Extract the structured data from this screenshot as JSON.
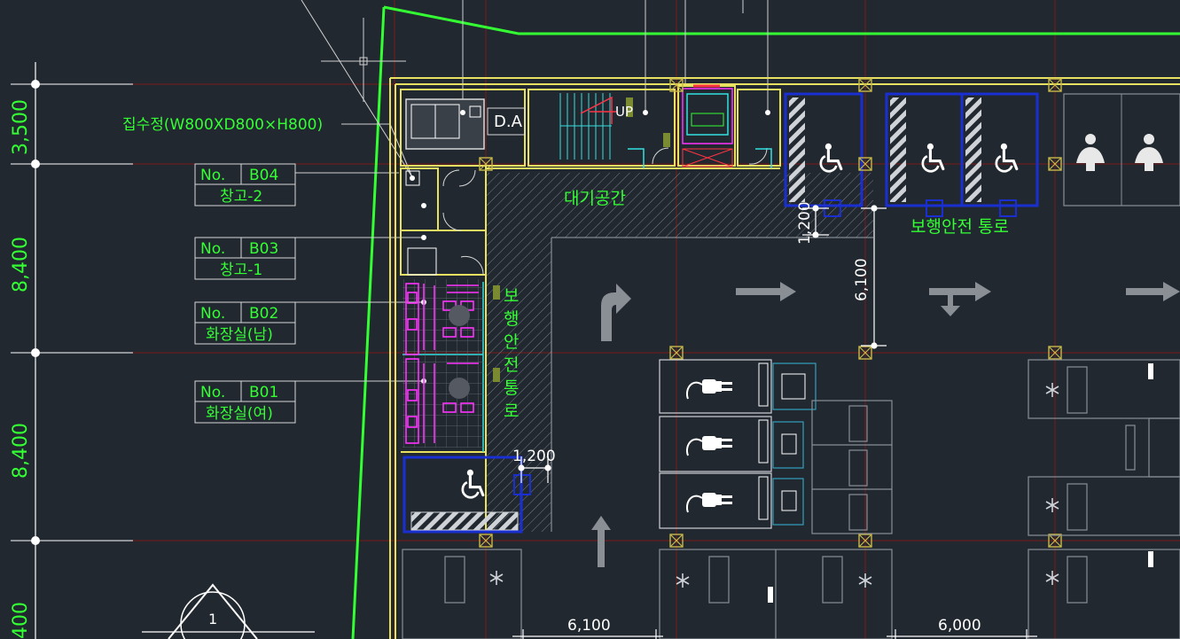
{
  "colors": {
    "background": "#212830",
    "annotation": "#33ff33",
    "wall": "#ffff66",
    "grid": "#8b1a1a",
    "accessible": "#1a2fd1",
    "restroom_fixture": "#ff33ff",
    "cyan": "#33e0e0",
    "white": "#ffffff",
    "gray": "#8a8f96"
  },
  "dimensions_left": [
    "3,500",
    "8,400",
    "8,400",
    "400"
  ],
  "dimensions_plan": [
    "1,200",
    "6,100",
    "1,200",
    "6,100",
    "6,000"
  ],
  "annotations": {
    "sump": "집수정(W800XD800×H800)",
    "waiting": "대기공간",
    "walkway_horizontal": "보행안전 통로",
    "walkway_vertical": [
      "보",
      "행",
      "안",
      "전",
      "통",
      "로"
    ],
    "da": "D.A",
    "up": "UP",
    "section_mark": "1"
  },
  "room_tags": [
    {
      "no_label": "No.",
      "code": "B04",
      "name": "창고-2"
    },
    {
      "no_label": "No.",
      "code": "B03",
      "name": "창고-1"
    },
    {
      "no_label": "No.",
      "code": "B02",
      "name": "화장실(남)"
    },
    {
      "no_label": "No.",
      "code": "B01",
      "name": "화장실(여)"
    }
  ],
  "icons": [
    "wheelchair-icon",
    "ev-plug-icon",
    "turn-arrow-icon",
    "straight-arrow-icon",
    "person-icon",
    "asterisk-icon"
  ]
}
